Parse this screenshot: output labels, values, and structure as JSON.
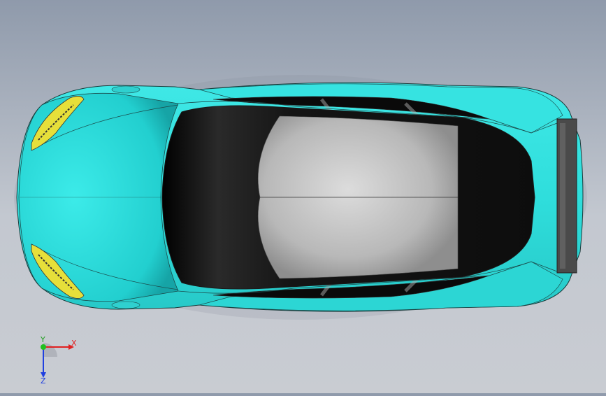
{
  "viewport": {
    "background_top": "#8f9aab",
    "background_bottom": "#c9ccd2"
  },
  "model": {
    "body_color": "#33e6e4",
    "body_shadow": "#1aa8ab",
    "glass_color": "#0a0a0a",
    "roof_color": "#c8c8c8",
    "headlight_color": "#e6df3a"
  },
  "triad": {
    "x_label": "X",
    "y_label": "Y",
    "z_label": "Z",
    "x_color": "#e02020",
    "y_color": "#20c020",
    "z_color": "#2040e0"
  }
}
